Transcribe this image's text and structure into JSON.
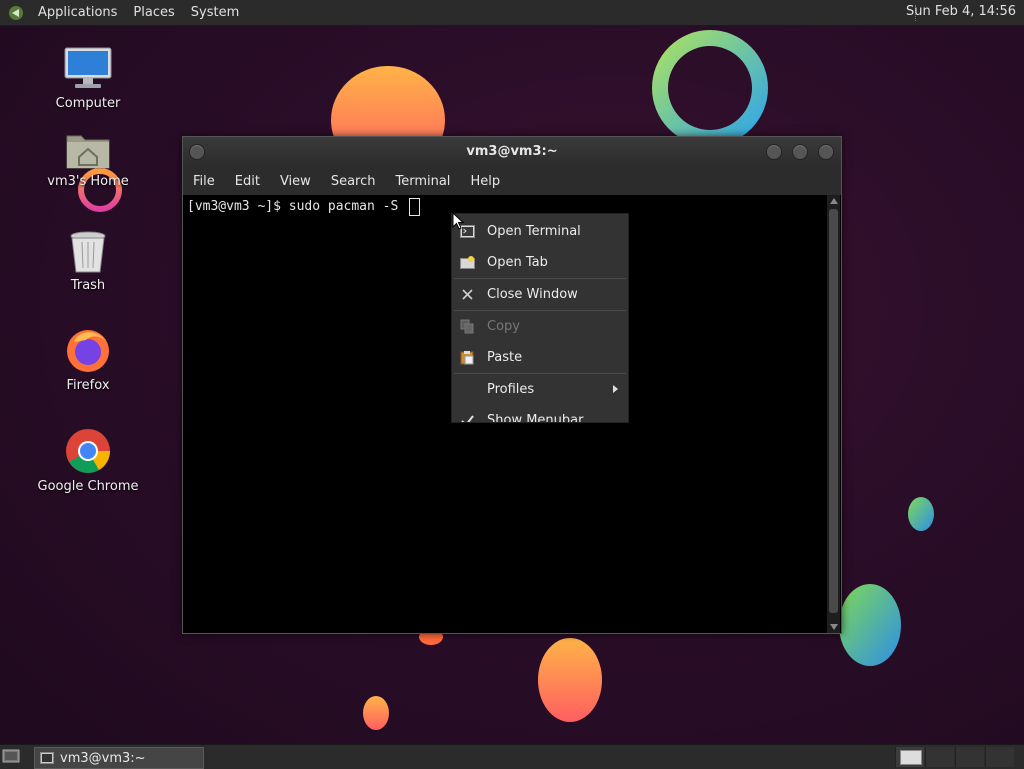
{
  "top_panel": {
    "menus": [
      "Applications",
      "Places",
      "System"
    ],
    "clock": "Sun Feb  4, 14:56"
  },
  "desktop_icons": [
    {
      "label": "Computer",
      "icon": "computer-icon"
    },
    {
      "label": "vm3's Home",
      "icon": "home-folder-icon"
    },
    {
      "label": "Trash",
      "icon": "trash-icon"
    },
    {
      "label": "Firefox",
      "icon": "firefox-icon"
    },
    {
      "label": "Google Chrome",
      "icon": "chrome-icon"
    }
  ],
  "terminal": {
    "title": "vm3@vm3:~",
    "menubar": [
      "File",
      "Edit",
      "View",
      "Search",
      "Terminal",
      "Help"
    ],
    "prompt": "[vm3@vm3 ~]$ sudo pacman -S "
  },
  "context_menu": {
    "items": [
      {
        "label": "Open Terminal",
        "icon": "terminal-icon",
        "enabled": true
      },
      {
        "label": "Open Tab",
        "icon": "new-tab-icon",
        "enabled": true
      },
      {
        "label": "Close Window",
        "icon": "close-icon",
        "enabled": true
      },
      {
        "label": "Copy",
        "icon": "copy-icon",
        "enabled": false
      },
      {
        "label": "Paste",
        "icon": "paste-icon",
        "enabled": true
      },
      {
        "label": "Profiles",
        "icon": "",
        "enabled": true,
        "submenu": true
      },
      {
        "label": "Show Menubar",
        "icon": "checkmark-icon",
        "enabled": true,
        "checked": true
      }
    ]
  },
  "taskbar": {
    "task_label": "vm3@vm3:~"
  },
  "colors": {
    "desktop_bg": "#2a0d28",
    "panel_bg": "#2b2b2b",
    "menu_bg": "#333333"
  }
}
